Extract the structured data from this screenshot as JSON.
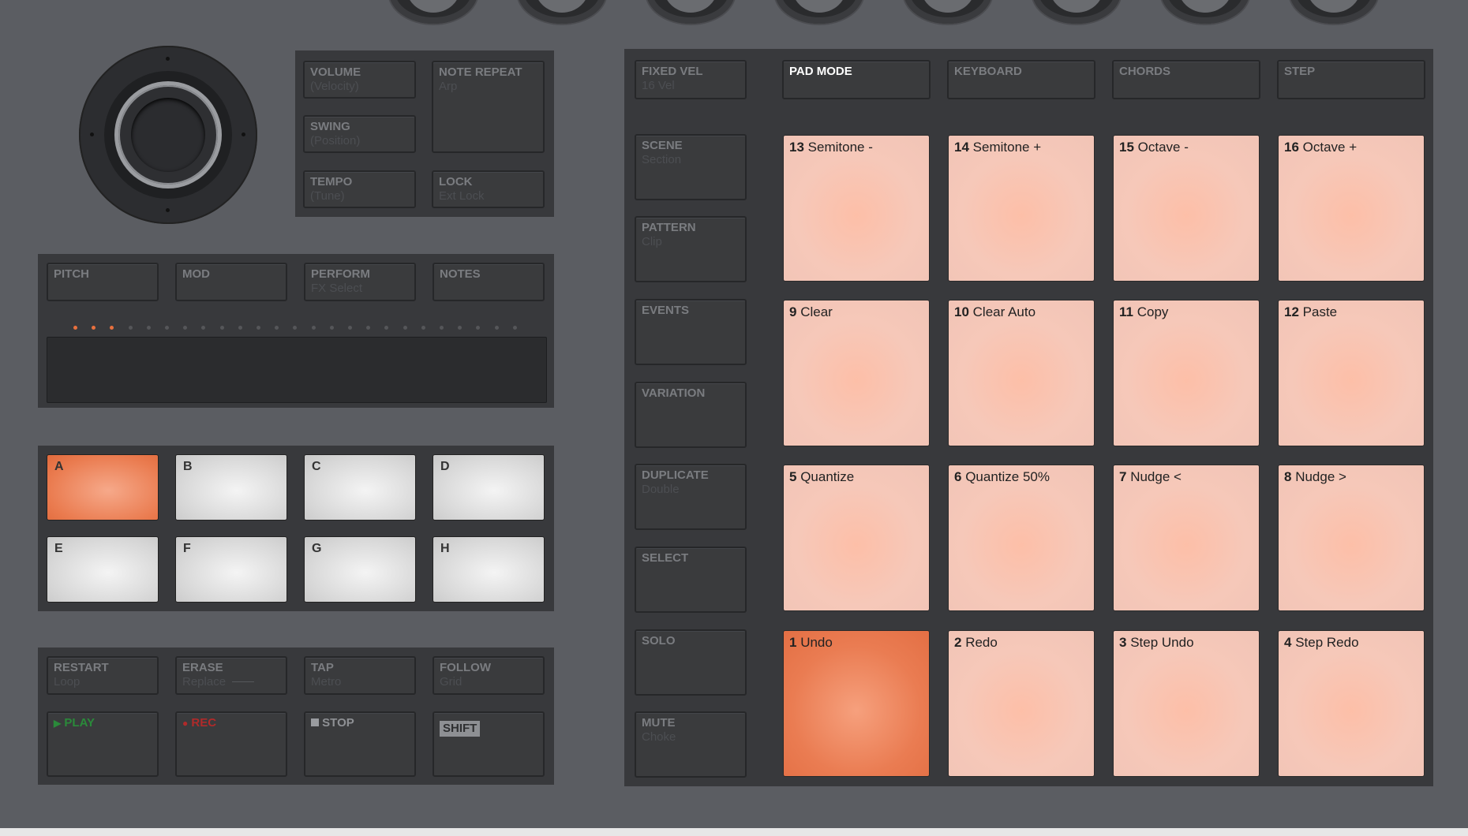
{
  "knobs": {
    "top_count": 8
  },
  "transport_top": {
    "volume": "VOLUME",
    "volume_sub": "(Velocity)",
    "swing": "SWING",
    "swing_sub": "(Position)",
    "tempo": "TEMPO",
    "tempo_sub": "(Tune)",
    "note_repeat": "NOTE REPEAT",
    "note_repeat_sub": "Arp",
    "lock": "LOCK",
    "lock_sub": "Ext Lock"
  },
  "strip_modes": {
    "pitch": "PITCH",
    "mod": "MOD",
    "perform": "PERFORM",
    "perform_sub": "FX Select",
    "notes": "NOTES"
  },
  "strip_leds": {
    "count": 25,
    "lit": 3
  },
  "groups": [
    "A",
    "B",
    "C",
    "D",
    "E",
    "F",
    "G",
    "H"
  ],
  "transport": {
    "restart": "RESTART",
    "restart_sub": "Loop",
    "erase": "ERASE",
    "erase_sub": "Replace",
    "tap": "TAP",
    "tap_sub": "Metro",
    "follow": "FOLLOW",
    "follow_sub": "Grid",
    "play": "PLAY",
    "rec": "REC",
    "stop": "STOP",
    "shift": "SHIFT"
  },
  "side_buttons": {
    "fixed_vel": "FIXED VEL",
    "fixed_vel_sub": "16 Vel",
    "scene": "SCENE",
    "scene_sub": "Section",
    "pattern": "PATTERN",
    "pattern_sub": "Clip",
    "events": "EVENTS",
    "variation": "VARIATION",
    "duplicate": "DUPLICATE",
    "duplicate_sub": "Double",
    "select": "SELECT",
    "solo": "SOLO",
    "mute": "MUTE",
    "mute_sub": "Choke"
  },
  "modes": {
    "pad_mode": "PAD MODE",
    "keyboard": "KEYBOARD",
    "chords": "CHORDS",
    "step": "STEP"
  },
  "pads": [
    {
      "num": "13",
      "label": "Semitone -"
    },
    {
      "num": "14",
      "label": "Semitone +"
    },
    {
      "num": "15",
      "label": "Octave -"
    },
    {
      "num": "16",
      "label": "Octave +"
    },
    {
      "num": "9",
      "label": "Clear"
    },
    {
      "num": "10",
      "label": "Clear Auto"
    },
    {
      "num": "11",
      "label": "Copy"
    },
    {
      "num": "12",
      "label": "Paste"
    },
    {
      "num": "5",
      "label": "Quantize"
    },
    {
      "num": "6",
      "label": "Quantize 50%"
    },
    {
      "num": "7",
      "label": "Nudge <"
    },
    {
      "num": "8",
      "label": "Nudge >"
    },
    {
      "num": "1",
      "label": "Undo"
    },
    {
      "num": "2",
      "label": "Redo"
    },
    {
      "num": "3",
      "label": "Step Undo"
    },
    {
      "num": "4",
      "label": "Step Redo"
    }
  ],
  "colors": {
    "accent": "#ea7b4f",
    "pad": "#f4c6b7",
    "group_inactive": "#d8d8d8"
  }
}
